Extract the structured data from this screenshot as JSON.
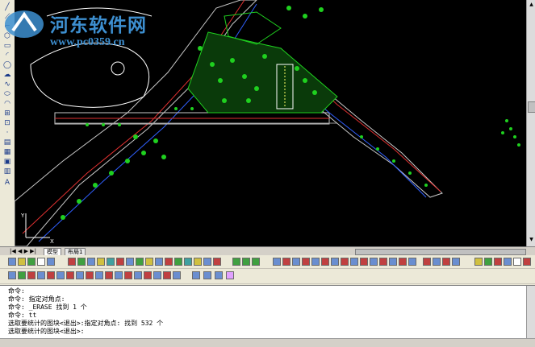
{
  "watermark": {
    "title": "河东软件网",
    "url": "www.pc0359.cn"
  },
  "layout_tabs": [
    "模型",
    "布局1"
  ],
  "command_lines": [
    "命令:",
    "命令: 指定对角点:",
    "命令: _ERASE 找到 1 个",
    "命令: tt",
    "选取要统计的图块<退出>:指定对角点: 找到 532 个",
    "选取要统计的图块<退出>:"
  ],
  "colors": {
    "background": "#000000",
    "road": "#c8c8c8",
    "vegetation": "#1fd01f",
    "curb": "#e03030",
    "lines": "#3060ff"
  },
  "icons": {
    "left_toolbar": [
      "line-icon",
      "polyline-icon",
      "polygon-icon",
      "rectangle-icon",
      "arc-icon",
      "circle-icon",
      "revcloud-icon",
      "spline-icon",
      "ellipse-icon",
      "ellipse-arc-icon",
      "insert-block-icon",
      "make-block-icon",
      "point-icon",
      "hatch-icon",
      "gradient-icon",
      "region-icon",
      "table-icon",
      "text-icon"
    ]
  }
}
